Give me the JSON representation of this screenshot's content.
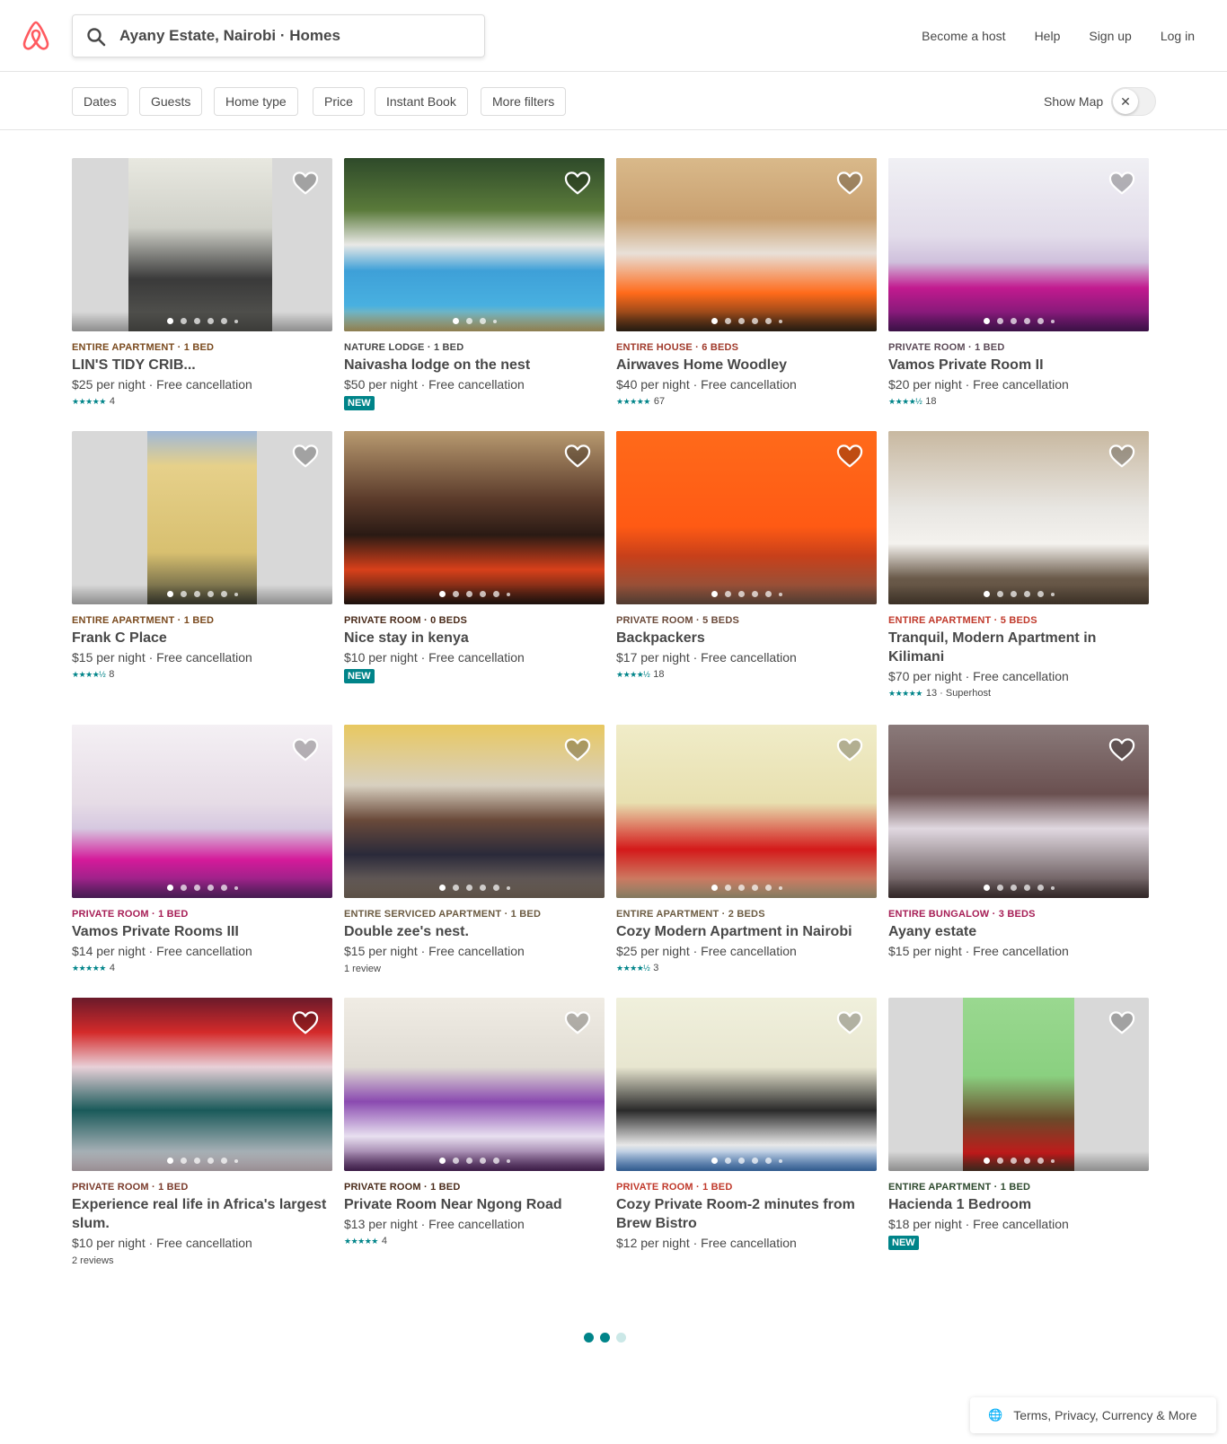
{
  "search": {
    "text": "Ayany Estate, Nairobi · Homes"
  },
  "nav": [
    {
      "label": "Become a host"
    },
    {
      "label": "Help"
    },
    {
      "label": "Sign up"
    },
    {
      "label": "Log in"
    }
  ],
  "filters": [
    {
      "label": "Dates"
    },
    {
      "label": "Guests"
    },
    {
      "label": "Home type"
    },
    {
      "label": "Price"
    },
    {
      "label": "Instant Book"
    },
    {
      "label": "More filters"
    }
  ],
  "show_map": {
    "label": "Show Map",
    "enabled": false,
    "toggle_glyph": "✕"
  },
  "colors": {
    "brand": "#ff5a5f",
    "teal": "#008489",
    "kind_home": "#784a21",
    "kind_room": "#9c1f4b",
    "kind_dark": "#484848",
    "kind_red": "#a61d55"
  },
  "listings": [
    {
      "kind": "ENTIRE APARTMENT · 1 BED",
      "kind_color": "#7a4a1e",
      "title": "LIN'S TIDY CRIB...",
      "price": "$25 per night · Free cancellation",
      "stars": "★★★★★",
      "rating": 5,
      "reviews": "4",
      "badge": "",
      "review_text": ""
    },
    {
      "kind": "NATURE LODGE · 1 BED",
      "kind_color": "#484848",
      "title": "Naivasha lodge on the nest",
      "price": "$50 per night · Free cancellation",
      "stars": "",
      "rating": null,
      "reviews": "",
      "badge": "NEW",
      "review_text": ""
    },
    {
      "kind": "ENTIRE HOUSE · 6 BEDS",
      "kind_color": "#a0392a",
      "title": "Airwaves Home Woodley",
      "price": "$40 per night · Free cancellation",
      "stars": "★★★★★",
      "rating": 5,
      "reviews": "67",
      "badge": "",
      "review_text": ""
    },
    {
      "kind": "PRIVATE ROOM · 1 BED",
      "kind_color": "#5c4a57",
      "title": "Vamos Private Room II",
      "price": "$20 per night · Free cancellation",
      "stars": "★★★★½",
      "rating": 4.5,
      "reviews": "18",
      "badge": "",
      "review_text": ""
    },
    {
      "kind": "ENTIRE APARTMENT · 1 BED",
      "kind_color": "#7a4a1e",
      "title": "Frank C Place",
      "price": "$15 per night · Free cancellation",
      "stars": "★★★★½",
      "rating": 4.5,
      "reviews": "8",
      "badge": "",
      "review_text": ""
    },
    {
      "kind": "PRIVATE ROOM · 0 BEDS",
      "kind_color": "#4a2b1a",
      "title": "Nice stay in kenya",
      "price": "$10 per night · Free cancellation",
      "stars": "",
      "rating": null,
      "reviews": "",
      "badge": "NEW",
      "review_text": ""
    },
    {
      "kind": "PRIVATE ROOM · 5 BEDS",
      "kind_color": "#6b4a3a",
      "title": "Backpackers",
      "price": "$17 per night · Free cancellation",
      "stars": "★★★★½",
      "rating": 4.5,
      "reviews": "18",
      "badge": "",
      "review_text": ""
    },
    {
      "kind": "ENTIRE APARTMENT · 5 BEDS",
      "kind_color": "#c0392b",
      "title": "Tranquil, Modern Apartment in Kilimani",
      "price": "$70 per night · Free cancellation",
      "stars": "★★★★★",
      "rating": 5,
      "reviews": "13 · Superhost",
      "badge": "",
      "review_text": ""
    },
    {
      "kind": "PRIVATE ROOM · 1 BED",
      "kind_color": "#a61d55",
      "title": "Vamos Private Rooms III",
      "price": "$14 per night · Free cancellation",
      "stars": "★★★★★",
      "rating": 5,
      "reviews": "4",
      "badge": "",
      "review_text": ""
    },
    {
      "kind": "ENTIRE SERVICED APARTMENT · 1 BED",
      "kind_color": "#6b5a40",
      "title": "Double zee's nest.",
      "price": "$15 per night · Free cancellation",
      "stars": "",
      "rating": null,
      "reviews": "",
      "badge": "",
      "review_text": "1 review"
    },
    {
      "kind": "ENTIRE APARTMENT · 2 BEDS",
      "kind_color": "#6b5a40",
      "title": "Cozy Modern Apartment in Nairobi",
      "price": "$25 per night · Free cancellation",
      "stars": "★★★★½",
      "rating": 4.5,
      "reviews": "3",
      "badge": "",
      "review_text": ""
    },
    {
      "kind": "ENTIRE BUNGALOW · 3 BEDS",
      "kind_color": "#a61d55",
      "title": "Ayany estate",
      "price": "$15 per night · Free cancellation",
      "stars": "",
      "rating": null,
      "reviews": "",
      "badge": "",
      "review_text": ""
    },
    {
      "kind": "PRIVATE ROOM · 1 BED",
      "kind_color": "#7a3b2b",
      "title": "Experience real life in Africa's largest slum.",
      "price": "$10 per night · Free cancellation",
      "stars": "",
      "rating": null,
      "reviews": "",
      "badge": "",
      "review_text": "2 reviews"
    },
    {
      "kind": "PRIVATE ROOM · 1 BED",
      "kind_color": "#4a2b1a",
      "title": "Private Room Near Ngong Road",
      "price": "$13 per night · Free cancellation",
      "stars": "★★★★★",
      "rating": 5,
      "reviews": "4",
      "badge": "",
      "review_text": ""
    },
    {
      "kind": "PRIVATE ROOM · 1 BED",
      "kind_color": "#c0392b",
      "title": "Cozy Private Room-2 minutes from Brew Bistro",
      "price": "$12 per night · Free cancellation",
      "stars": "",
      "rating": null,
      "reviews": "",
      "badge": "",
      "review_text": ""
    },
    {
      "kind": "ENTIRE APARTMENT · 1 BED",
      "kind_color": "#2e4a2e",
      "title": "Hacienda 1 Bedroom",
      "price": "$18 per night · Free cancellation",
      "stars": "",
      "rating": null,
      "reviews": "",
      "badge": "NEW",
      "review_text": ""
    }
  ],
  "pagination": {
    "pages": 3,
    "current": 1
  },
  "footer": {
    "label": "Terms, Privacy, Currency & More"
  }
}
